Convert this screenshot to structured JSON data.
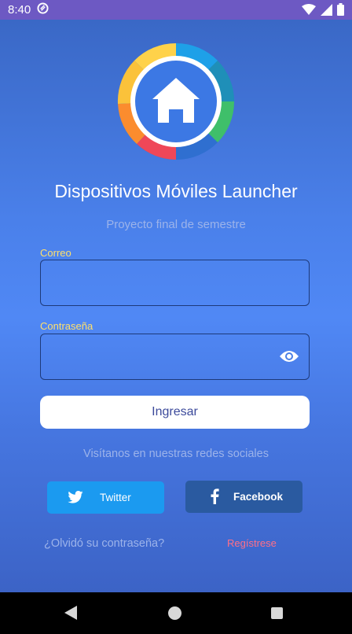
{
  "status_bar": {
    "time": "8:40",
    "icons": [
      "sync-icon",
      "wifi-icon",
      "signal-icon",
      "battery-icon"
    ]
  },
  "app": {
    "logo_icon": "home-icon",
    "title": "Dispositivos Móviles Launcher",
    "subtitle": "Proyecto final de semestre"
  },
  "form": {
    "email_label": "Correo",
    "email_value": "",
    "password_label": "Contraseña",
    "password_value": "",
    "password_toggle_icon": "eye-icon",
    "submit_label": "Ingresar"
  },
  "social": {
    "prompt": "Visítanos en nuestras redes sociales",
    "twitter_label": "Twitter",
    "facebook_label": "Facebook"
  },
  "links": {
    "forgot_password": "¿Olvidó su contraseña?",
    "register": "Regístrese"
  },
  "colors": {
    "status_bar": "#6d59c3",
    "label_accent": "#ffe06b",
    "register_link": "#ff6f87",
    "twitter": "#1b9af0",
    "facebook": "#2a5aa0"
  }
}
